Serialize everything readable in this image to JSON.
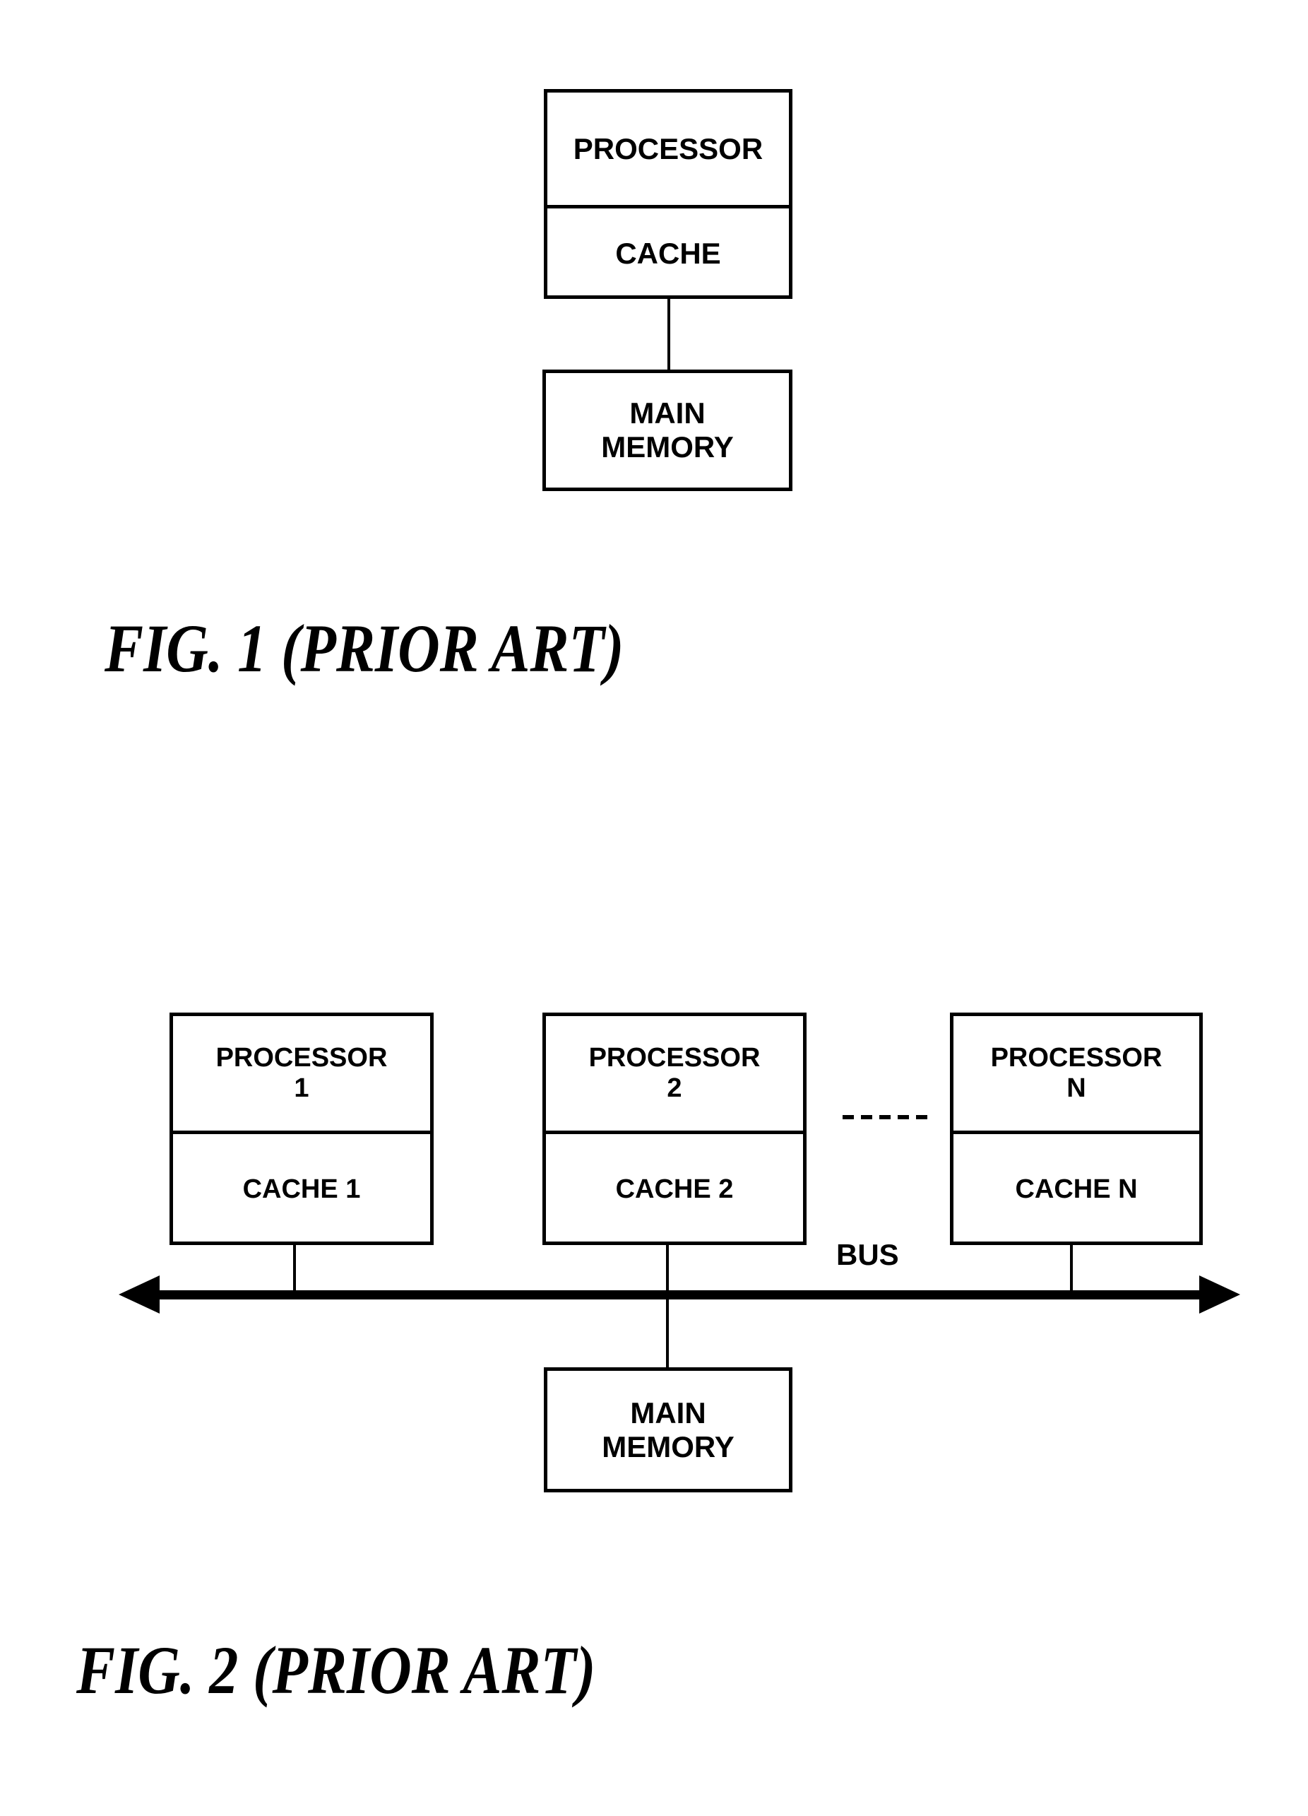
{
  "figures": [
    {
      "id": "fig1",
      "caption": "FIG. 1 (PRIOR ART)",
      "nodes": {
        "processor": "PROCESSOR",
        "cache": "CACHE",
        "main_memory": "MAIN\nMEMORY"
      }
    },
    {
      "id": "fig2",
      "caption": "FIG. 2 (PRIOR ART)",
      "bus_label": "BUS",
      "ellipsis_dash_count": 5,
      "nodes": {
        "processor_1": "PROCESSOR\n1",
        "cache_1": "CACHE 1",
        "processor_2": "PROCESSOR\n2",
        "cache_2": "CACHE 2",
        "processor_n": "PROCESSOR\nN",
        "cache_n": "CACHE N",
        "main_memory": "MAIN\nMEMORY"
      }
    }
  ],
  "fig1": {
    "caption": "FIG. 1 (PRIOR ART)",
    "processor": "PROCESSOR",
    "cache": "CACHE",
    "main_memory_line1": "MAIN",
    "main_memory_line2": "MEMORY"
  },
  "fig2": {
    "caption": "FIG. 2 (PRIOR ART)",
    "bus_label": "BUS",
    "processor_1_line1": "PROCESSOR",
    "processor_1_line2": "1",
    "cache_1": "CACHE 1",
    "processor_2_line1": "PROCESSOR",
    "processor_2_line2": "2",
    "cache_2": "CACHE 2",
    "processor_n_line1": "PROCESSOR",
    "processor_n_line2": "N",
    "cache_n": "CACHE N",
    "main_memory_line1": "MAIN",
    "main_memory_line2": "MEMORY"
  },
  "colors": {
    "ink": "#000000",
    "paper": "#ffffff"
  }
}
